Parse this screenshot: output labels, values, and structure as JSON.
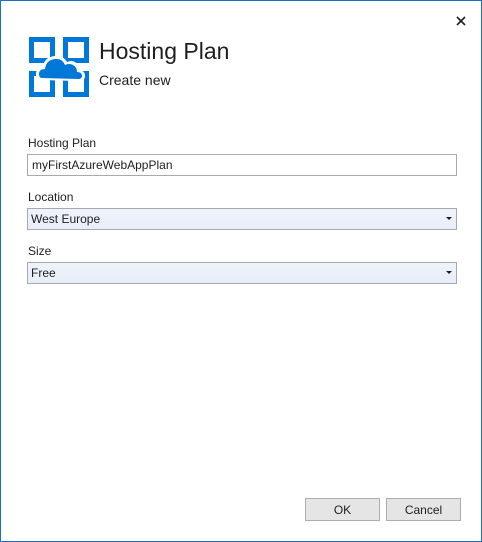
{
  "dialog": {
    "title": "Hosting Plan",
    "subtitle": "Create new",
    "logo_icon": "azure-cloud-hosting-icon",
    "close_icon": "close-icon",
    "accent_color": "#1c6fc5",
    "logo_color": "#0078d7"
  },
  "form": {
    "hosting_plan": {
      "label": "Hosting Plan",
      "value": "myFirstAzureWebAppPlan"
    },
    "location": {
      "label": "Location",
      "selected": "West Europe"
    },
    "size": {
      "label": "Size",
      "selected": "Free"
    }
  },
  "buttons": {
    "ok_label": "OK",
    "cancel_label": "Cancel"
  }
}
